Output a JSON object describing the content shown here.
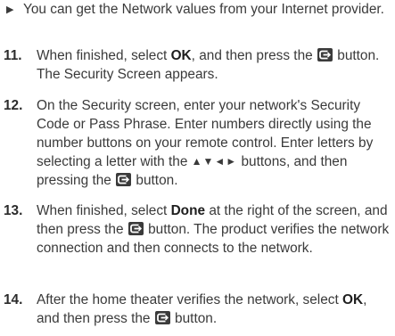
{
  "intro": {
    "bullet_text": "You can get the Network values from your Internet provider."
  },
  "steps": [
    {
      "number": "11.",
      "t1": "When finished, select ",
      "b1": "OK",
      "t2": ", and then press the ",
      "t3": " button. The Security Screen appears."
    },
    {
      "number": "12.",
      "t1": "On the Security screen, enter your network's Security Code or Pass Phrase. Enter numbers directly using the number buttons on your remote control. Enter letters by selecting a letter with the ",
      "arrows": "▲▼◄►",
      "t2": " buttons, and then pressing the ",
      "t3": " button."
    },
    {
      "number": "13.",
      "t1": "When finished, select ",
      "b1": "Done",
      "t2": " at the right of the screen, and then press the ",
      "t3": " button. The product verifies the network connection and then connects to the network."
    },
    {
      "number": "14.",
      "t1": "After the home theater verifies the network, select ",
      "b1": "OK",
      "t2": ", and then press the ",
      "t3": " button."
    }
  ]
}
